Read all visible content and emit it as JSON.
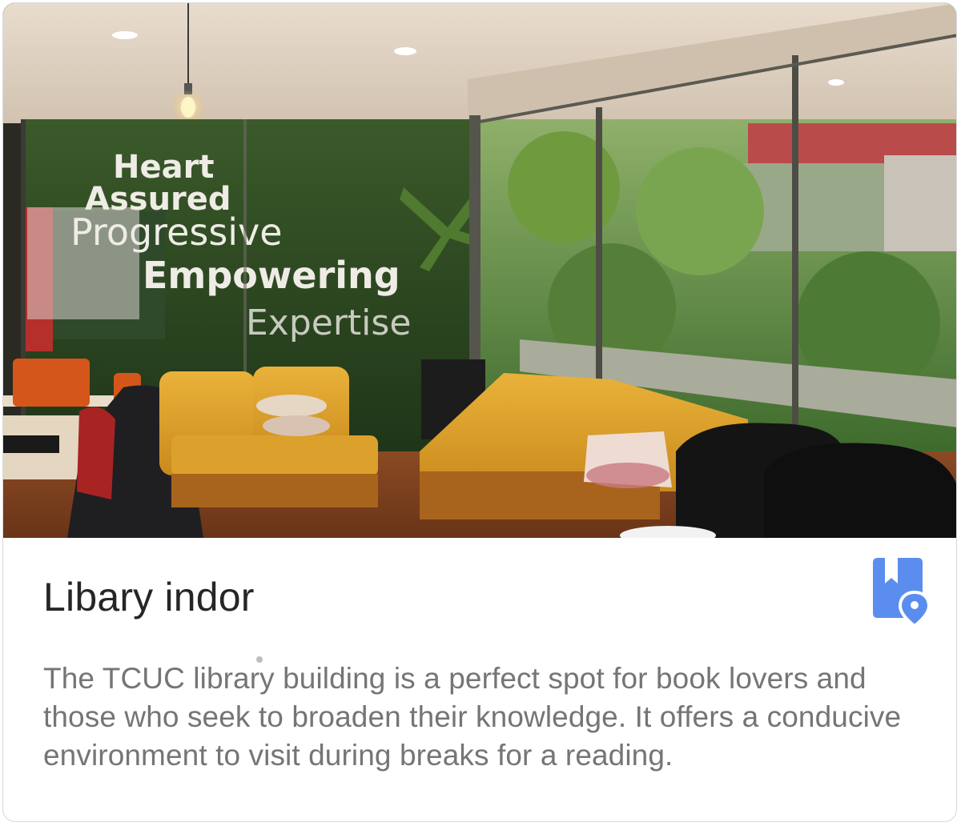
{
  "card": {
    "title": "Libary indor",
    "description": "The TCUC library building is a perfect spot for book lovers and those who seek to broaden their knowledge. It offers a conducive environment to visit during breaks for a reading.",
    "bookmark_icon": "bookmark-location-icon",
    "accent_color": "#5b8def"
  },
  "photo": {
    "wall_words": [
      "Heart",
      "Assured",
      "Progressive",
      "Empowering",
      "Expertise"
    ]
  }
}
